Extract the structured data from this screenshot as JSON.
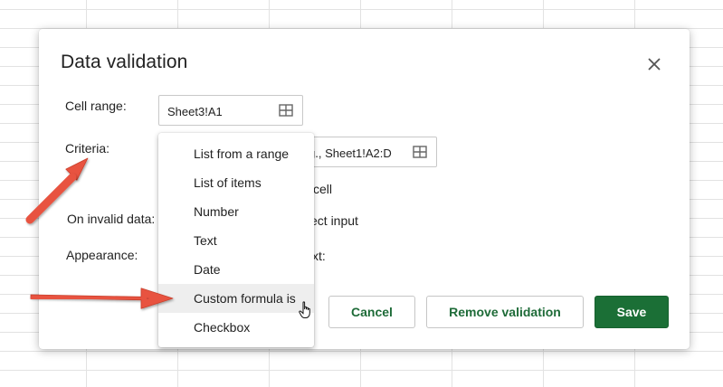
{
  "dialog": {
    "title": "Data validation",
    "cell_range": {
      "label": "Cell range:",
      "value": "Sheet3!A1"
    },
    "criteria": {
      "label": "Criteria:",
      "range_placeholder": "g., Sheet1!A2:D",
      "partial_option": "cell"
    },
    "on_invalid": {
      "label": "On invalid data:",
      "partial_value": "ect input"
    },
    "appearance": {
      "label": "Appearance:",
      "partial_value": "xt:"
    },
    "buttons": {
      "cancel": "Cancel",
      "remove": "Remove validation",
      "save": "Save"
    }
  },
  "criteria_menu": {
    "items": [
      "List from a range",
      "List of items",
      "Number",
      "Text",
      "Date",
      "Custom formula is",
      "Checkbox"
    ],
    "highlighted": "Custom formula is"
  },
  "icons": {
    "close": "close-icon",
    "range": "grid-icon",
    "cursor": "hand-pointer-icon",
    "annotation": "arrow-annotation"
  },
  "colors": {
    "accent": "#1b6f36",
    "annotation_arrow": "#e8533f"
  }
}
